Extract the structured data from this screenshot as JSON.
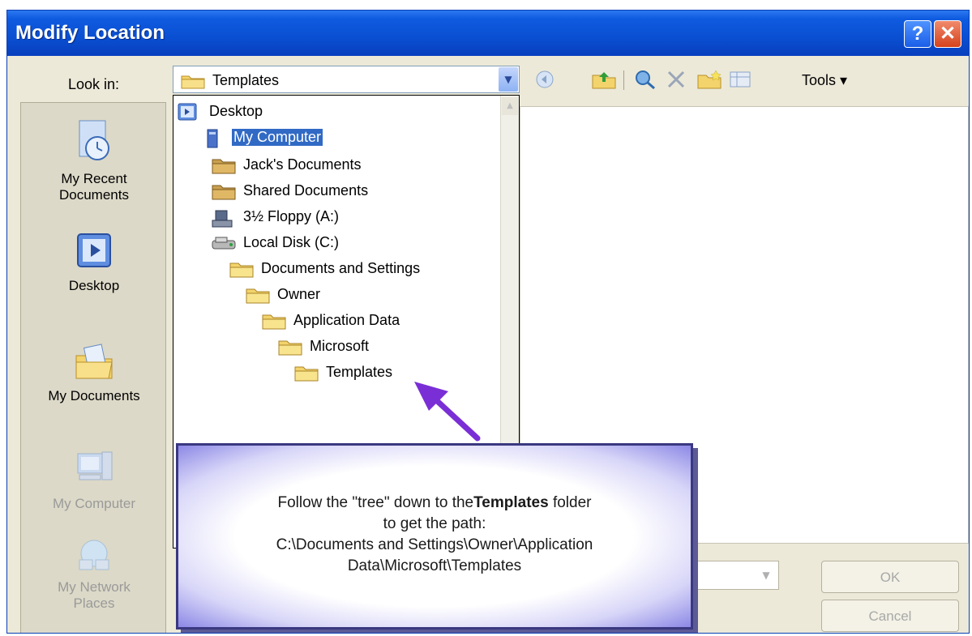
{
  "window": {
    "title": "Modify Location",
    "help_label": "?",
    "close_label": "✕"
  },
  "lookin": {
    "label": "Look in:",
    "value": "Templates"
  },
  "toolbar": {
    "tools_label": "Tools ▾"
  },
  "places": [
    {
      "label_line1": "My Recent",
      "label_line2": "Documents",
      "icon": "recent-documents-icon"
    },
    {
      "label_line1": "Desktop",
      "label_line2": "",
      "icon": "desktop-icon"
    },
    {
      "label_line1": "My Documents",
      "label_line2": "",
      "icon": "my-documents-icon"
    },
    {
      "label_line1": "My Computer",
      "label_line2": "",
      "icon": "my-computer-icon"
    },
    {
      "label_line1": "My Network",
      "label_line2": "Places",
      "icon": "network-places-icon"
    }
  ],
  "tree": [
    {
      "label": "Desktop",
      "icon": "desktop-icon"
    },
    {
      "label": "My Computer",
      "icon": "computer-icon",
      "selected": true
    },
    {
      "label": "Jack's Documents",
      "icon": "folder-icon"
    },
    {
      "label": "Shared Documents",
      "icon": "folder-icon"
    },
    {
      "label": "3½ Floppy (A:)",
      "icon": "floppy-icon"
    },
    {
      "label": "Local Disk (C:)",
      "icon": "disk-icon"
    },
    {
      "label": "Documents and Settings",
      "icon": "folder-icon"
    },
    {
      "label": "Owner",
      "icon": "folder-icon"
    },
    {
      "label": "Application Data",
      "icon": "folder-icon"
    },
    {
      "label": "Microsoft",
      "icon": "folder-icon"
    },
    {
      "label": "Templates",
      "icon": "folder-icon"
    }
  ],
  "buttons": {
    "ok": "OK",
    "cancel": "Cancel"
  },
  "callout": {
    "line1_pre": "Follow the \"tree\" down to the",
    "line1_bold": "Templates",
    "line1_post": " folder",
    "line2": "to get the path:",
    "line3": "C:\\Documents and Settings\\Owner\\Application",
    "line4": "Data\\Microsoft\\Templates"
  },
  "colors": {
    "titlebar": "#0a4fd2",
    "selection": "#316ac5",
    "callout_border": "#3a3880",
    "arrow": "#7a2fd6"
  }
}
